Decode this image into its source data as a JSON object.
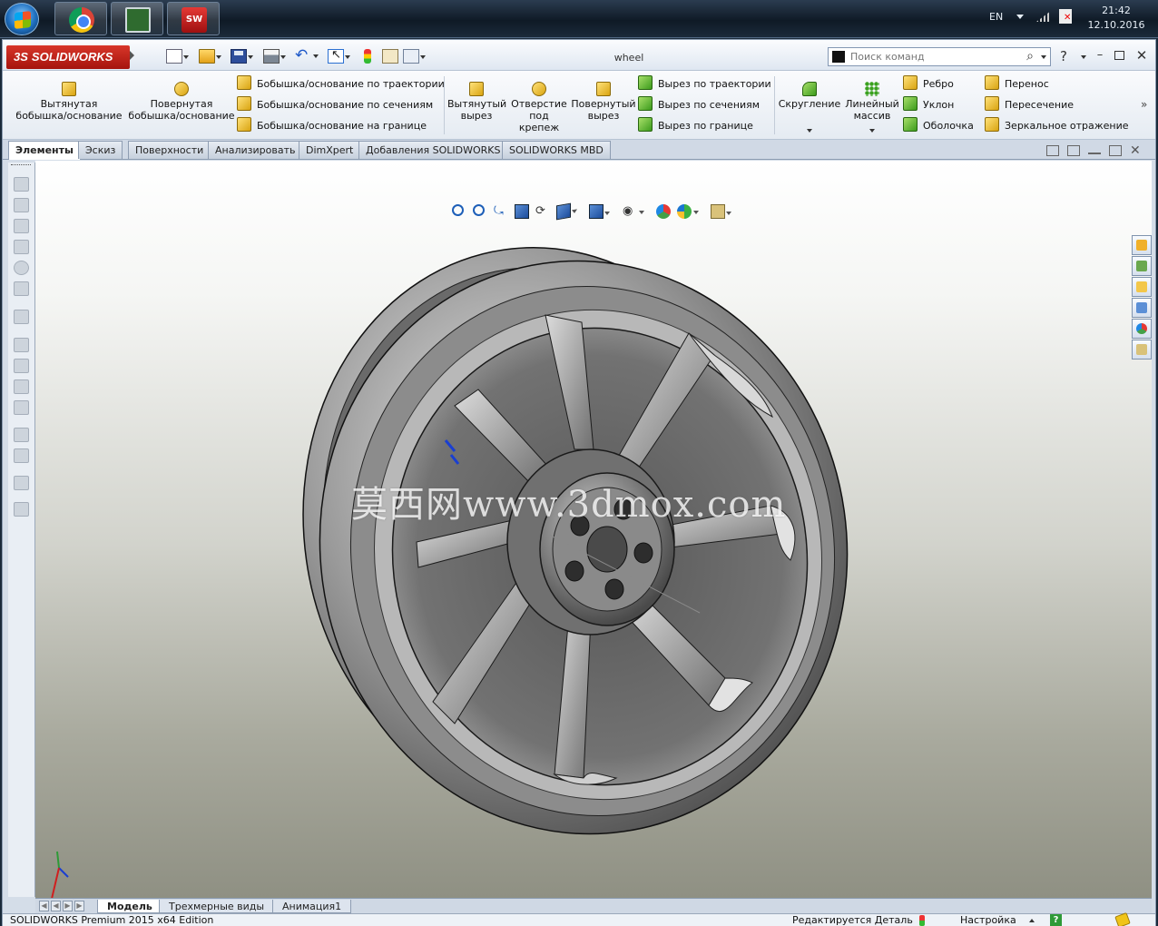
{
  "taskbar": {
    "language": "EN",
    "time": "21:42",
    "date": "12.10.2016",
    "apps": [
      "chrome-icon",
      "monitor-app-icon",
      "solidworks-2015-icon"
    ],
    "sw_badge": "SW"
  },
  "titlebar": {
    "logo_ds": "3S",
    "logo_text": "SOLIDWORKS",
    "document_name": "wheel",
    "search_placeholder": "Поиск команд",
    "help": "?"
  },
  "ribbon": {
    "extruded_boss": "Вытянутая бобышка/основание",
    "revolved_boss": "Повернутая бобышка/основание",
    "swept_boss": "Бобышка/основание по траектории",
    "lofted_boss": "Бобышка/основание по сечениям",
    "boundary_boss": "Бобышка/основание на границе",
    "extruded_cut": "Вытянутый вырез",
    "hole_wizard": "Отверстие под крепеж",
    "revolved_cut": "Повернутый вырез",
    "swept_cut": "Вырез по траектории",
    "lofted_cut": "Вырез по сечениям",
    "boundary_cut": "Вырез по границе",
    "fillet": "Скругление",
    "linear_pattern": "Линейный массив",
    "rib": "Ребро",
    "draft": "Уклон",
    "shell": "Оболочка",
    "move": "Перенос",
    "intersect": "Пересечение",
    "mirror": "Зеркальное отражение",
    "more": "»"
  },
  "tabs": [
    "Элементы",
    "Эскиз",
    "Поверхности",
    "Анализировать",
    "DimXpert",
    "Добавления SOLIDWORKS",
    "SOLIDWORKS MBD"
  ],
  "active_tab": "Элементы",
  "viewport": {
    "watermark": "莫西网www.3dmox.com"
  },
  "model_tabs": [
    "Модель",
    "Трехмерные виды",
    "Анимация1"
  ],
  "active_model_tab": "Модель",
  "statusbar": {
    "edition": "SOLIDWORKS Premium 2015 x64 Edition",
    "editing": "Редактируется Деталь",
    "customize": "Настройка",
    "help": "?"
  }
}
